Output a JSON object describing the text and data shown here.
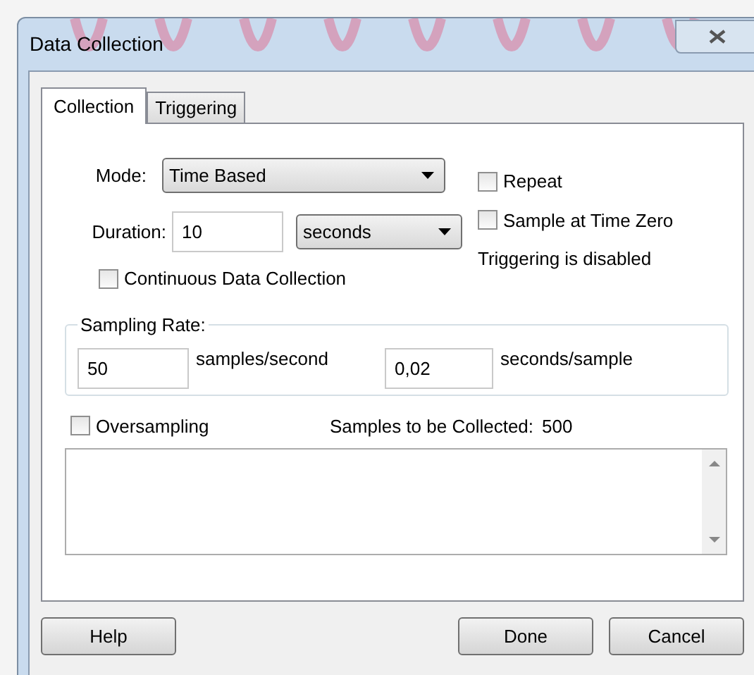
{
  "window": {
    "title": "Data Collection"
  },
  "tabs": [
    {
      "label": "Collection",
      "selected": true
    },
    {
      "label": "Triggering",
      "selected": false
    }
  ],
  "mode": {
    "label": "Mode:",
    "value": "Time Based"
  },
  "duration": {
    "label": "Duration:",
    "value": "10",
    "unit": "seconds"
  },
  "options": [
    {
      "label": "Repeat",
      "checked": false
    },
    {
      "label": "Sample at Time Zero",
      "checked": false
    }
  ],
  "triggering_note": "Triggering is disabled",
  "continuous": {
    "label": "Continuous Data Collection",
    "checked": false
  },
  "sampling_rate": {
    "title": "Sampling Rate:",
    "rate": "50",
    "rate_unit": "samples/second",
    "interval": "0,02",
    "interval_unit": "seconds/sample"
  },
  "oversampling": {
    "label": "Oversampling",
    "checked": false
  },
  "samples_label": "Samples to be Collected:",
  "samples_value": "500",
  "buttons": [
    "Help",
    "Done",
    "Cancel"
  ]
}
